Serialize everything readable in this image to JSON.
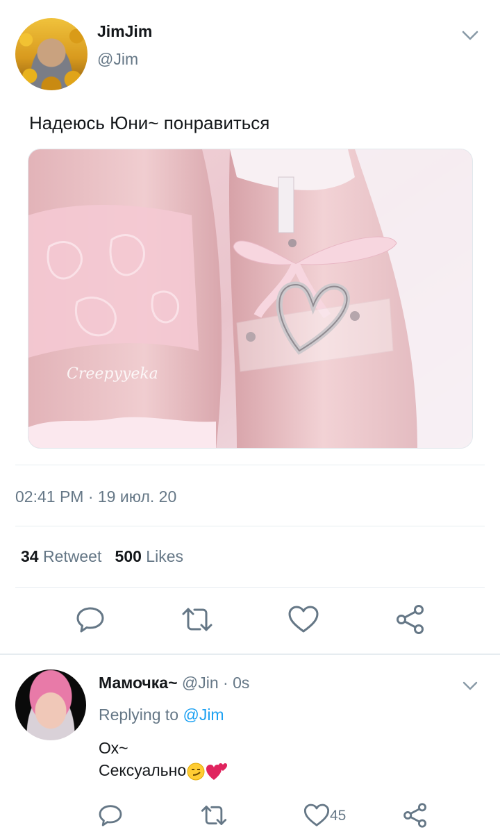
{
  "tweet": {
    "display_name": "JimJim",
    "handle": "@Jim",
    "text": "Надеюсь Юни~ понравиться",
    "image_watermark": "Creepyyeka",
    "timestamp": "02:41 PM · 19 июл. 20",
    "retweets_count": "34",
    "retweets_label": "Retweet",
    "likes_count": "500",
    "likes_label": "Likes"
  },
  "reply": {
    "display_name": "Мамочка~",
    "handle": "@Jin",
    "time": "· 0s",
    "replying_prefix": "Replying to",
    "replying_to": "@Jim",
    "line1": "Ох~",
    "line2": "Сексуально",
    "like_count": "45"
  },
  "icons": {
    "reply": "speech-bubble-icon",
    "retweet": "retweet-icon",
    "like": "heart-icon",
    "share": "share-icon",
    "menu": "chevron-down-icon"
  },
  "colors": {
    "text": "#14171a",
    "secondary": "#657786",
    "link": "#1da1f2",
    "divider": "#e6ecf0"
  }
}
